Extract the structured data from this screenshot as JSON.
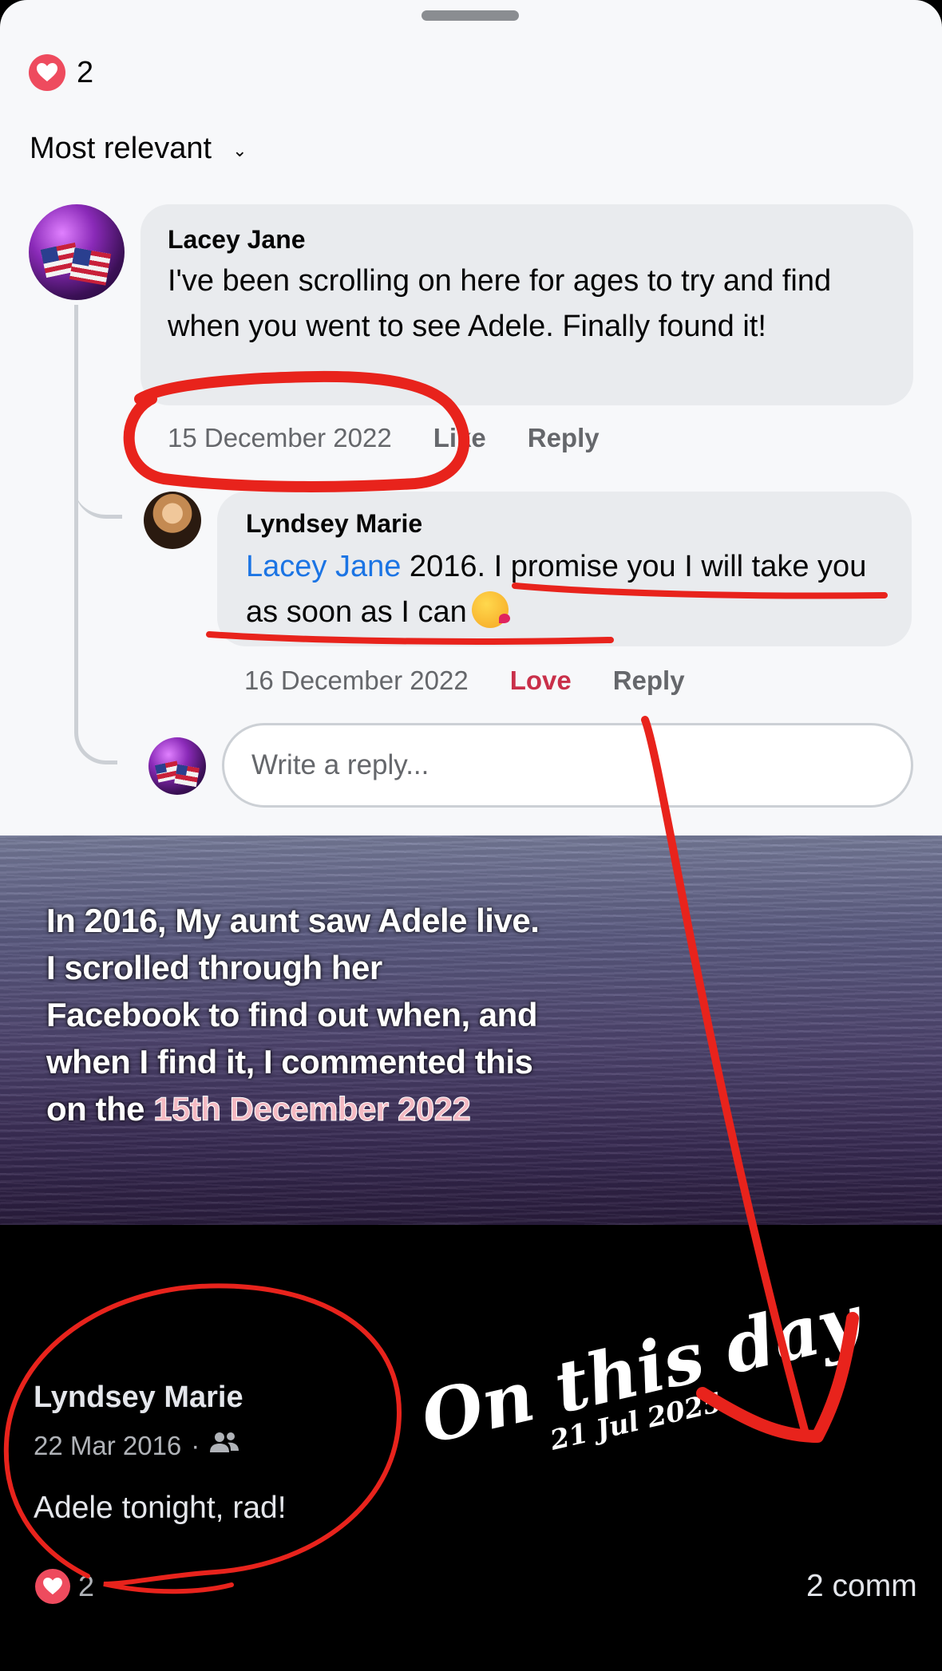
{
  "sheet": {
    "reactions": {
      "count": "2"
    },
    "sort_label": "Most relevant",
    "comments": [
      {
        "author": "Lacey Jane",
        "text": "I've been scrolling on here for ages to try and find when you went to see Adele. Finally found it!",
        "date": "15 December 2022",
        "like_label": "Like",
        "reply_label": "Reply"
      },
      {
        "author": "Lyndsey Marie",
        "mention": "Lacey Jane",
        "text": " 2016. I promise you I will take you as soon as I can",
        "date": "16 December 2022",
        "reaction_label": "Love",
        "reply_label": "Reply"
      }
    ],
    "reply_placeholder": "Write a reply..."
  },
  "caption": {
    "text": "In 2016, My aunt saw Adele live. I scrolled through her Facebook to find out when, and when I find it, I commented this on the ",
    "highlight": "15th December 2022"
  },
  "post": {
    "author": "Lyndsey Marie",
    "date": "22 Mar 2016",
    "separator": "·",
    "audience_icon": "friends-icon",
    "text": "Adele tonight, rad!",
    "reactions_count": "2",
    "comments_label": "2 comm"
  },
  "overlay": {
    "title": "On this day",
    "date": "21 Jul 2025"
  },
  "colors": {
    "annotation_red": "#e8231c",
    "reaction_heart": "#ee4b5e",
    "mention_blue": "#1b74e4",
    "love_red": "#c9304a"
  }
}
